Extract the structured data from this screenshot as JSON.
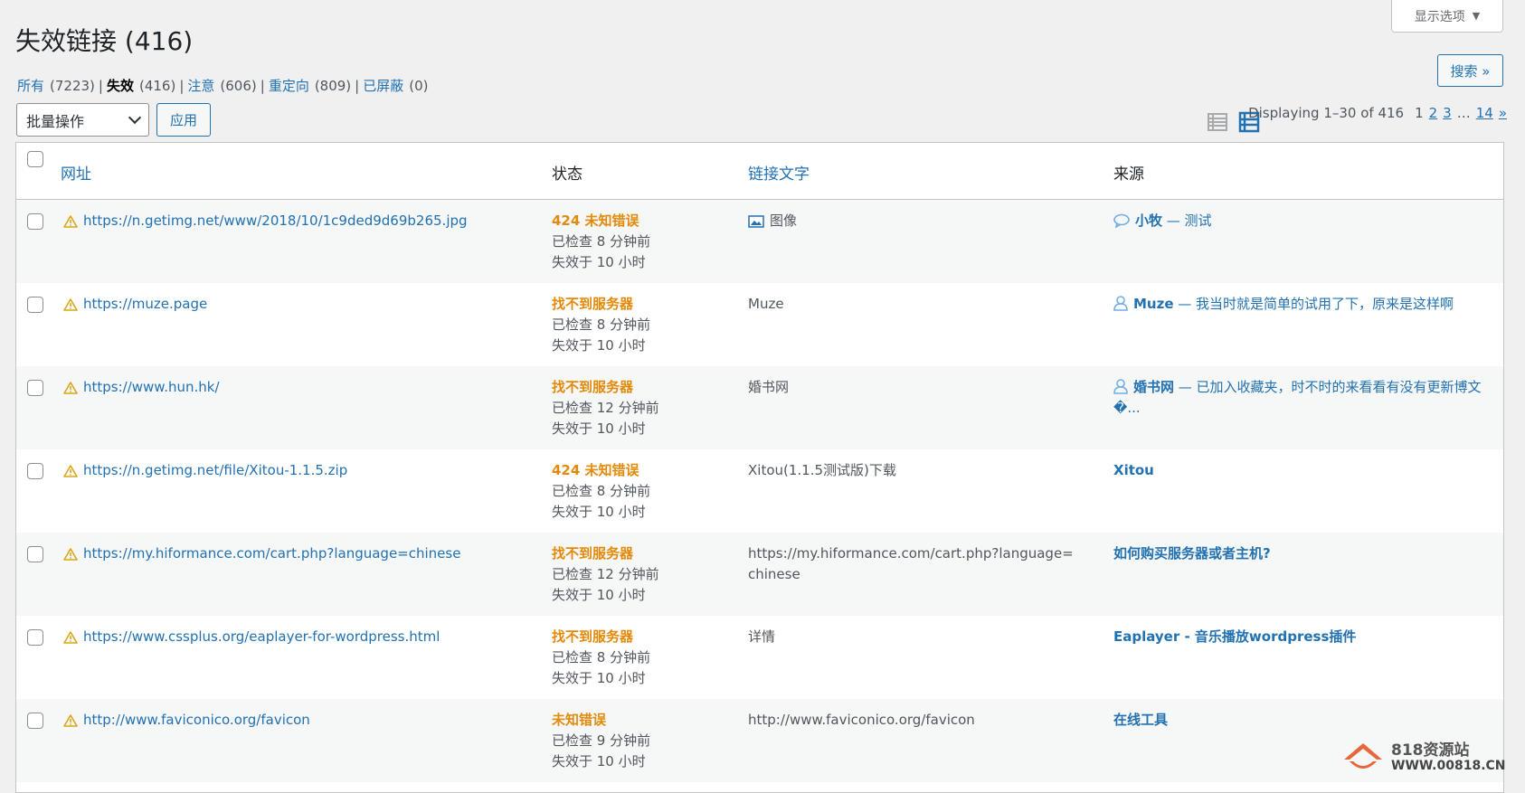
{
  "header": {
    "title": "失效链接 (416)",
    "screen_options": "显示选项",
    "search_button": "搜索 »"
  },
  "filters": [
    {
      "label": "所有",
      "count": "(7223)",
      "current": false
    },
    {
      "label": "失效",
      "count": "(416)",
      "current": true
    },
    {
      "label": "注意",
      "count": "(606)",
      "current": false
    },
    {
      "label": "重定向",
      "count": "(809)",
      "current": false
    },
    {
      "label": "已屏蔽",
      "count": "(0)",
      "current": false
    }
  ],
  "bulk": {
    "select_value": "批量操作",
    "apply_label": "应用"
  },
  "pagination": {
    "displaying": "Displaying 1–30 of 416",
    "pages": [
      "1",
      "2",
      "3"
    ],
    "ellipsis": "…",
    "last": "14",
    "next": "»"
  },
  "table": {
    "columns": [
      "网址",
      "状态",
      "链接文字",
      "来源"
    ],
    "rows": [
      {
        "url": "https://n.getimg.net/www/2018/10/1c9ded9d69b265.jpg",
        "status": "424 未知错误",
        "checked": "已检查 8 分钟前",
        "failed": "失效于 10 小时",
        "text": "图像",
        "text_icon": "image-icon",
        "source_bold": "小牧",
        "source_rest": " — 测试",
        "source_icon": "comment-icon"
      },
      {
        "url": "https://muze.page",
        "status": "找不到服务器",
        "checked": "已检查 8 分钟前",
        "failed": "失效于 10 小时",
        "text": "Muze",
        "text_icon": "",
        "source_bold": "Muze",
        "source_rest": " — 我当时就是简单的试用了下，原来是这样啊",
        "source_icon": "user-icon"
      },
      {
        "url": "https://www.hun.hk/",
        "status": "找不到服务器",
        "checked": "已检查 12 分钟前",
        "failed": "失效于 10 小时",
        "text": "婚书网",
        "text_icon": "",
        "source_bold": "婚书网",
        "source_rest": " — 已加入收藏夹，时不时的来看看有没有更新博文�...",
        "source_icon": "user-icon"
      },
      {
        "url": "https://n.getimg.net/file/Xitou-1.1.5.zip",
        "status": "424 未知错误",
        "checked": "已检查 8 分钟前",
        "failed": "失效于 10 小时",
        "text": "Xitou(1.1.5测试版)下载",
        "text_icon": "",
        "source_bold": "Xitou",
        "source_rest": "",
        "source_icon": ""
      },
      {
        "url": "https://my.hiformance.com/cart.php?language=chinese",
        "status": "找不到服务器",
        "checked": "已检查 12 分钟前",
        "failed": "失效于 10 小时",
        "text": "https://my.hiformance.com/cart.php?language=chinese",
        "text_icon": "",
        "source_bold": "如何购买服务器或者主机?",
        "source_rest": "",
        "source_icon": ""
      },
      {
        "url": "https://www.cssplus.org/eaplayer-for-wordpress.html",
        "status": "找不到服务器",
        "checked": "已检查 8 分钟前",
        "failed": "失效于 10 小时",
        "text": "详情",
        "text_icon": "",
        "source_bold": "Eaplayer - 音乐播放wordpress插件",
        "source_rest": "",
        "source_icon": ""
      },
      {
        "url": "http://www.faviconico.org/favicon",
        "status": "未知错误",
        "checked": "已检查 9 分钟前",
        "failed": "失效于 10 小时",
        "text": "http://www.faviconico.org/favicon",
        "text_icon": "",
        "source_bold": "在线工具",
        "source_rest": "",
        "source_icon": ""
      }
    ]
  },
  "watermark": {
    "text": "818资源站",
    "url": "WWW.00818.CN"
  },
  "colors": {
    "link": "#2271b1",
    "status": "#e38a0b",
    "warning": "#dba617"
  }
}
